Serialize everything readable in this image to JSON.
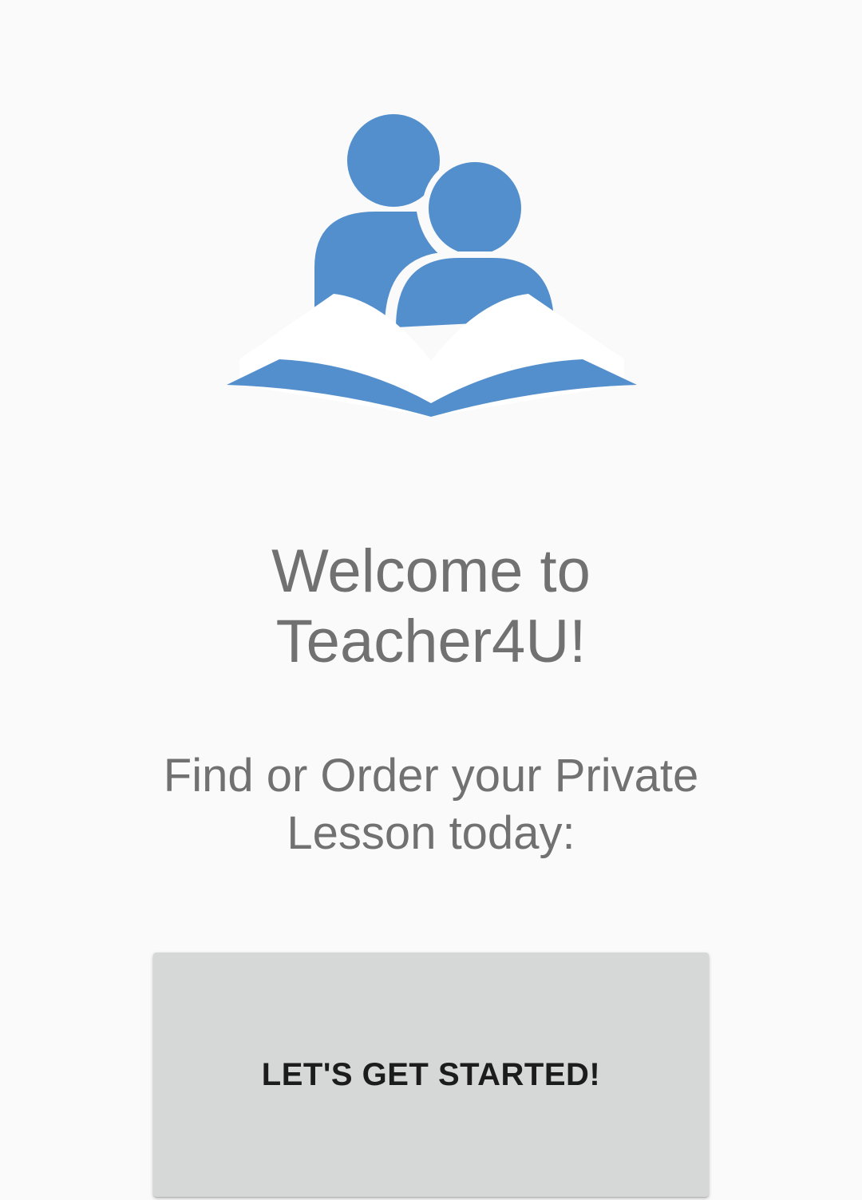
{
  "app": {
    "name": "Teacher4U",
    "logo_icon": "teacher-student-book-logo",
    "accent_color": "#548fcd"
  },
  "welcome": {
    "line1": "Welcome to",
    "line2": "Teacher4U!"
  },
  "tagline": {
    "line1": "Find or Order your Private",
    "line2": "Lesson today:"
  },
  "cta": {
    "label": "LET'S GET STARTED!"
  },
  "colors": {
    "background": "#fafafa",
    "text": "#717171",
    "button": "#d6d7d7",
    "button_text": "#1c1c1c"
  }
}
